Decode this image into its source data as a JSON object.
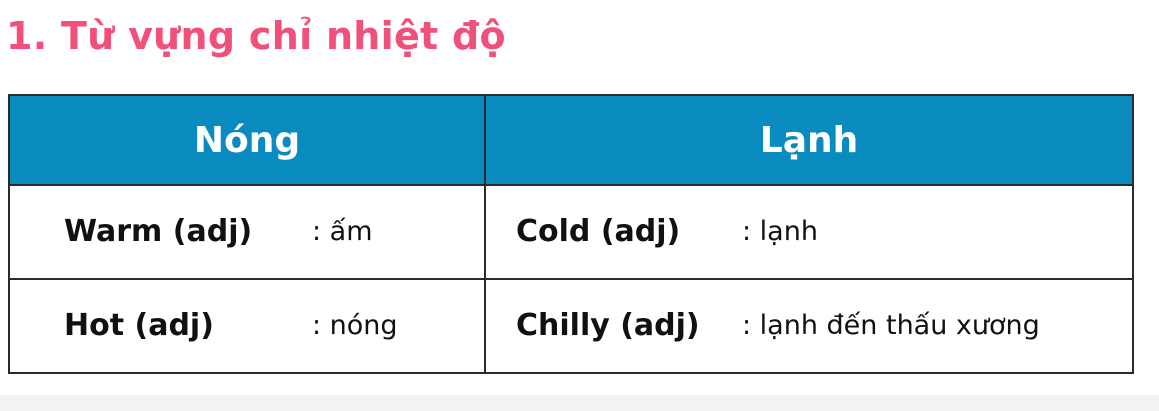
{
  "heading": "1. Từ vựng chỉ nhiệt độ",
  "table": {
    "headers": [
      "Nóng",
      "Lạnh"
    ],
    "rows": [
      {
        "hot_term": "Warm (adj)",
        "hot_meaning": ": ấm",
        "cold_term": "Cold (adj)",
        "cold_meaning": ": lạnh"
      },
      {
        "hot_term": "Hot (adj)",
        "hot_meaning": ": nóng",
        "cold_term": "Chilly (adj)",
        "cold_meaning": ": lạnh đến thấu xương"
      }
    ]
  },
  "colors": {
    "heading": "#f0507a",
    "header_bg": "#0a8bc0",
    "header_text": "#ffffff",
    "border": "#2a2a2a"
  }
}
